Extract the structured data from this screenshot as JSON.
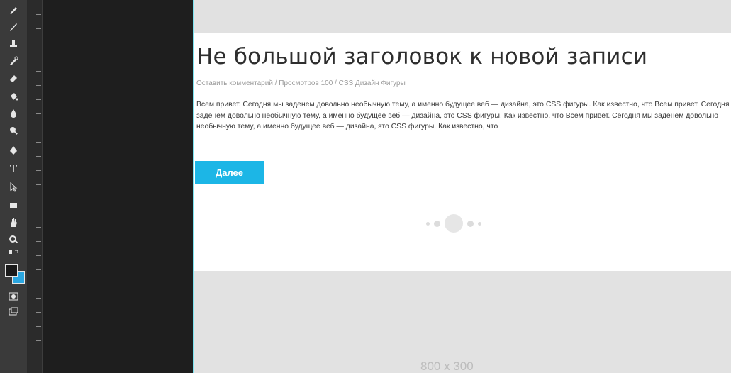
{
  "toolbar": {
    "tools": [
      {
        "icon": "brush-icon"
      },
      {
        "icon": "pencil-icon"
      },
      {
        "icon": "stamp-icon"
      },
      {
        "icon": "history-brush-icon"
      },
      {
        "icon": "eraser-icon"
      },
      {
        "icon": "paint-bucket-icon"
      },
      {
        "icon": "blur-icon"
      },
      {
        "icon": "dodge-icon"
      },
      {
        "icon": "pen-icon"
      },
      {
        "icon": "type-icon",
        "glyph": "T"
      },
      {
        "icon": "path-selection-icon"
      },
      {
        "icon": "rectangle-icon"
      },
      {
        "icon": "hand-icon"
      },
      {
        "icon": "zoom-icon"
      }
    ],
    "colors": {
      "foreground": "#1a1a1a",
      "background": "#2aa6e0"
    }
  },
  "post": {
    "title": "Не большой заголовок к новой записи",
    "meta": "Оставить комментарий / Просмотров 100 / CSS Дизайн Фигуры",
    "excerpt": "Всем привет. Сегодня мы заденем довольно необычную тему, а именно будущее веб — дизайна, это CSS фигуры. Как известно, что Всем привет. Сегодня мы заденем довольно необычную тему, а именно будущее веб — дизайна, это CSS фигуры. Как известно, что Всем привет. Сегодня мы заденем довольно необычную тему, а именно будущее веб — дизайна, это CSS фигуры. Как известно, что",
    "more_label": "Далее"
  },
  "placeholder": {
    "size_label": "800 x 300"
  },
  "colors": {
    "accent": "#1cb6e6",
    "guide": "#7ee3f0"
  }
}
